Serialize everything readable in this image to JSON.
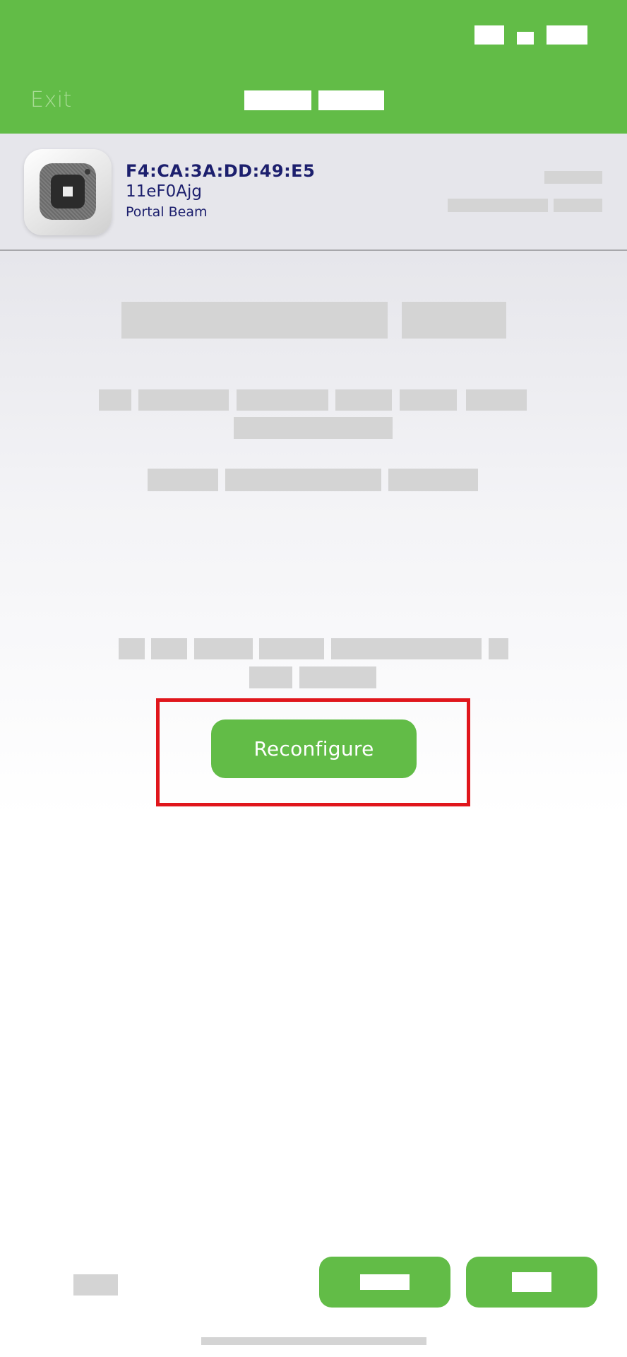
{
  "header": {
    "exit_label": "Exit",
    "background_color": "#62bc47"
  },
  "device": {
    "mac_address": "F4:CA:3A:DD:49:E5",
    "device_id": "11eF0Ajg",
    "device_type": "Portal Beam",
    "icon": "portal-beam-device-icon"
  },
  "actions": {
    "reconfigure_label": "Reconfigure"
  },
  "colors": {
    "accent": "#62bc47",
    "text_primary": "#1c1f6d",
    "highlight": "#e0161c",
    "redacted": "#d4d4d4"
  }
}
